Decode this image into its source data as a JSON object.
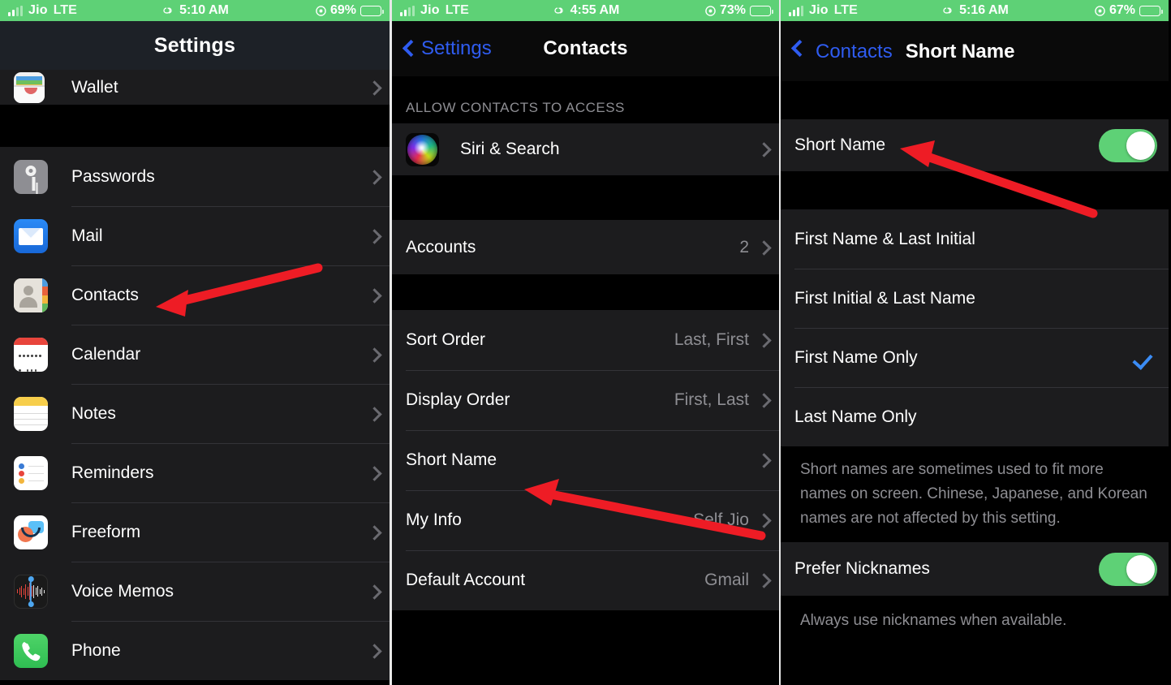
{
  "panels": [
    {
      "status": {
        "carrier": "Jio",
        "network": "LTE",
        "time": "5:10 AM",
        "battery": "69%",
        "battery_level": 69
      },
      "nav": {
        "title": "Settings"
      },
      "rows_top": [
        {
          "label": "Wallet",
          "icon": "wallet-icon",
          "accessory": "chevron"
        }
      ],
      "rows": [
        {
          "label": "Passwords",
          "icon": "passwords-key-icon",
          "accessory": "chevron"
        },
        {
          "label": "Mail",
          "icon": "mail-envelope-icon",
          "accessory": "chevron"
        },
        {
          "label": "Contacts",
          "icon": "contacts-icon",
          "accessory": "chevron"
        },
        {
          "label": "Calendar",
          "icon": "calendar-icon",
          "accessory": "chevron"
        },
        {
          "label": "Notes",
          "icon": "notes-icon",
          "accessory": "chevron"
        },
        {
          "label": "Reminders",
          "icon": "reminders-icon",
          "accessory": "chevron"
        },
        {
          "label": "Freeform",
          "icon": "freeform-icon",
          "accessory": "chevron"
        },
        {
          "label": "Voice Memos",
          "icon": "voice-memos-icon",
          "accessory": "chevron"
        },
        {
          "label": "Phone",
          "icon": "phone-icon",
          "accessory": "chevron"
        }
      ]
    },
    {
      "status": {
        "carrier": "Jio",
        "network": "LTE",
        "time": "4:55 AM",
        "battery": "73%",
        "battery_level": 73
      },
      "nav": {
        "back_label": "Settings",
        "title": "Contacts"
      },
      "section_header": "ALLOW CONTACTS TO ACCESS",
      "group_siri": [
        {
          "label": "Siri & Search",
          "icon": "siri-icon",
          "accessory": "chevron"
        }
      ],
      "group_accounts": [
        {
          "label": "Accounts",
          "value": "2",
          "accessory": "chevron"
        }
      ],
      "group_order": [
        {
          "label": "Sort Order",
          "value": "Last, First",
          "accessory": "chevron"
        },
        {
          "label": "Display Order",
          "value": "First, Last",
          "accessory": "chevron"
        },
        {
          "label": "Short Name",
          "value": "",
          "accessory": "chevron"
        },
        {
          "label": "My Info",
          "value": "Self Jio",
          "accessory": "chevron"
        },
        {
          "label": "Default Account",
          "value": "Gmail",
          "accessory": "chevron"
        }
      ]
    },
    {
      "status": {
        "carrier": "Jio",
        "network": "LTE",
        "time": "5:16 AM",
        "battery": "67%",
        "battery_level": 67
      },
      "nav": {
        "back_label": "Contacts",
        "title": "Short Name"
      },
      "toggle_row": {
        "label": "Short Name",
        "on": true
      },
      "options": [
        {
          "label": "First Name & Last Initial",
          "selected": false
        },
        {
          "label": "First Initial & Last Name",
          "selected": false
        },
        {
          "label": "First Name Only",
          "selected": true
        },
        {
          "label": "Last Name Only",
          "selected": false
        }
      ],
      "footer": "Short names are sometimes used to fit more names on screen. Chinese, Japanese, and Korean names are not affected by this setting.",
      "nickname_row": {
        "label": "Prefer Nicknames",
        "on": true
      },
      "nickname_footer": "Always use nicknames when available."
    }
  ],
  "colors": {
    "status_bar_green": "#5ed176",
    "toggle_green": "#5ed176",
    "link_blue": "#2f5cf0",
    "check_blue": "#3b8cf5",
    "annotation_red": "#ee1c25",
    "row_bg": "#1c1c1e",
    "page_bg": "#000000",
    "secondary_text": "#8e8e93"
  },
  "annotations": [
    {
      "name": "arrow-to-contacts",
      "panel": 1,
      "target": "Contacts"
    },
    {
      "name": "arrow-to-short-name",
      "panel": 2,
      "target": "Short Name"
    },
    {
      "name": "arrow-to-short-name-toggle-row",
      "panel": 3,
      "target": "Short Name"
    }
  ]
}
